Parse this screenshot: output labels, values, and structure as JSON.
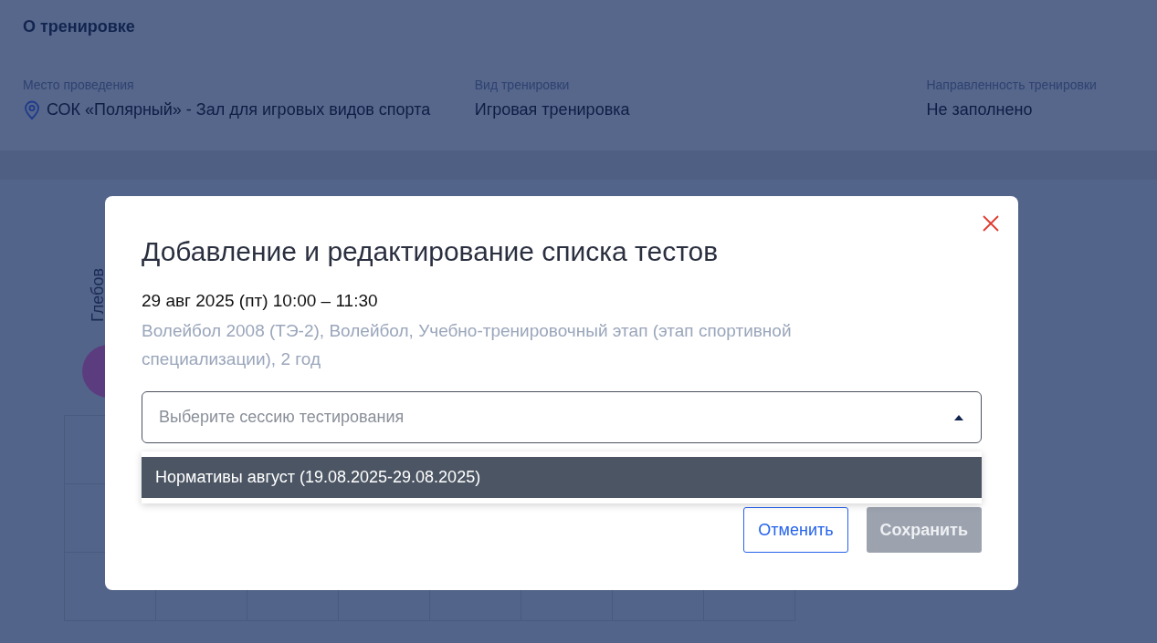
{
  "section": {
    "title": "О тренировке",
    "fields": [
      {
        "label": "Место проведения",
        "value": "СОК «Полярный» - Зал для игровых видов спорта"
      },
      {
        "label": "Вид тренировки",
        "value": "Игровая тренировка"
      },
      {
        "label": "Направленность тренировки",
        "value": "Не заполнено"
      }
    ]
  },
  "athlete": {
    "name": "Глебов"
  },
  "dialog": {
    "title": "Добавление и редактирование списка тестов",
    "datetime": "29 авг 2025 (пт) 10:00 – 11:30",
    "group": "Волейбол 2008 (ТЭ-2), Волейбол, Учебно-тренировочный этап (этап спортивной специализации), 2 год",
    "select": {
      "placeholder": "Выберите сессию тестирования",
      "expanded": true,
      "options": [
        {
          "label": "Нормативы август (19.08.2025-29.08.2025)",
          "selected": true
        }
      ]
    },
    "buttons": [
      {
        "label": "Отменить",
        "kind": "outline",
        "disabled": false
      },
      {
        "label": "Сохранить",
        "kind": "primary",
        "disabled": true
      }
    ]
  }
}
